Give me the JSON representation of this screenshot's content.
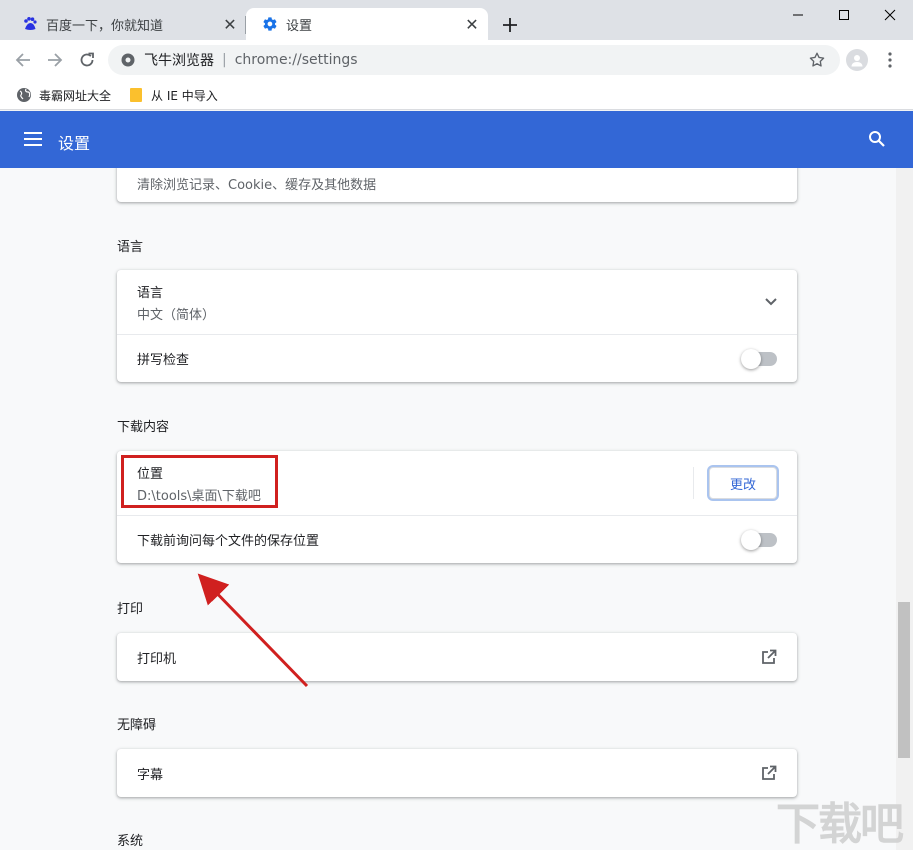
{
  "tabs": [
    {
      "title": "百度一下，你就知道",
      "icon": "baidu-paw-icon"
    },
    {
      "title": "设置",
      "icon": "gear-icon"
    }
  ],
  "toolbar": {
    "browser_name": "飞牛浏览器",
    "separator": "|",
    "url": "chrome://settings"
  },
  "bookmarks": [
    {
      "label": "毒霸网址大全",
      "icon": "globe-icon"
    },
    {
      "label": "从 IE 中导入",
      "icon": "folder-icon"
    }
  ],
  "header": {
    "title": "设置"
  },
  "sections": {
    "privacy_row_sub": "清除浏览记录、Cookie、缓存及其他数据",
    "language": {
      "title": "语言",
      "lang_label": "语言",
      "lang_value": "中文（简体）",
      "spellcheck_label": "拼写检查",
      "spellcheck_on": false
    },
    "downloads": {
      "title": "下载内容",
      "location_label": "位置",
      "location_value": "D:\\tools\\桌面\\下载吧",
      "change_button": "更改",
      "ask_label": "下载前询问每个文件的保存位置",
      "ask_on": false
    },
    "printing": {
      "title": "打印",
      "printers_label": "打印机"
    },
    "accessibility": {
      "title": "无障碍",
      "captions_label": "字幕"
    },
    "system": {
      "title": "系统"
    }
  },
  "watermark": "下载吧",
  "colors": {
    "accent": "#3367d6",
    "annotation": "#d0201f"
  }
}
